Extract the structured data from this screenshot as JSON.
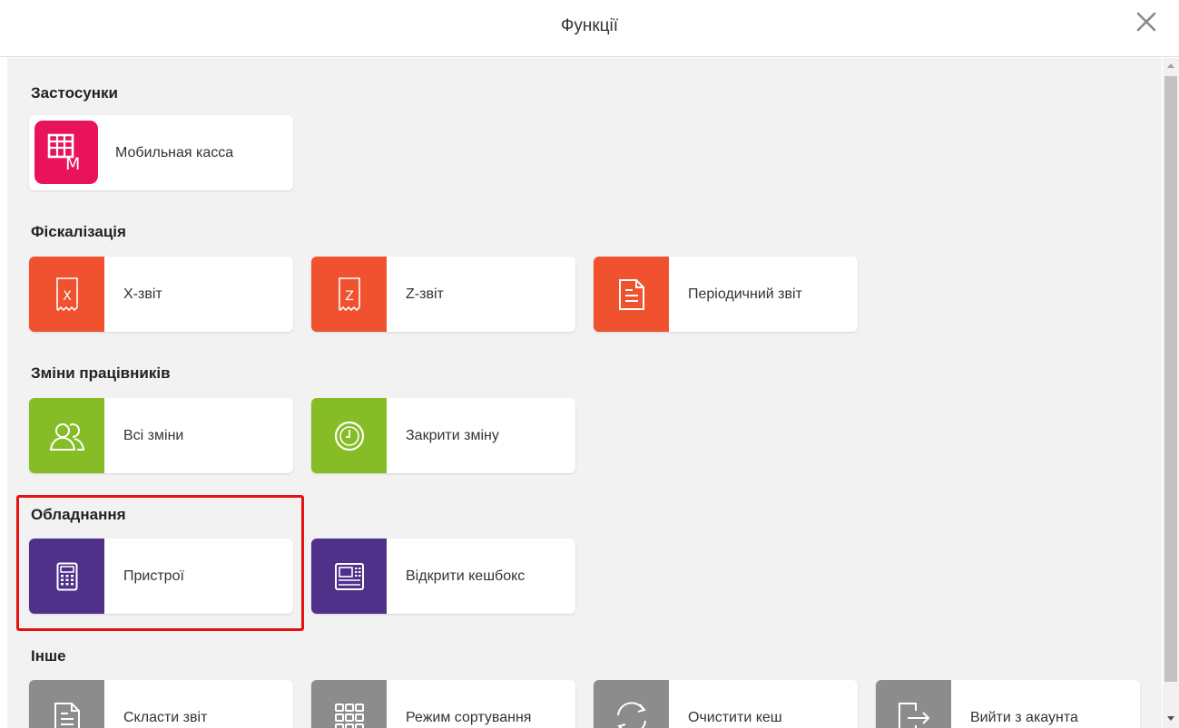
{
  "header": {
    "title": "Функції",
    "close_icon": "close-icon"
  },
  "colors": {
    "app": "#e8135a",
    "fiscal": "#f0522f",
    "shifts": "#86bc25",
    "equipment": "#50318a",
    "other": "#8c8c8c",
    "highlight": "#e81010"
  },
  "sections": {
    "apps": {
      "title": "Застосунки",
      "items": [
        {
          "label": "Мобильная касса",
          "icon": "mobile-cash-register-icon",
          "icon_letter": "M"
        }
      ]
    },
    "fiscal": {
      "title": "Фіскалізація",
      "items": [
        {
          "label": "X-звіт",
          "icon": "x-report-icon",
          "icon_letter": "X"
        },
        {
          "label": "Z-звіт",
          "icon": "z-report-icon",
          "icon_letter": "Z"
        },
        {
          "label": "Періодичний звіт",
          "icon": "document-icon"
        }
      ]
    },
    "shifts": {
      "title": "Зміни працівників",
      "items": [
        {
          "label": "Всі зміни",
          "icon": "users-icon"
        },
        {
          "label": "Закрити зміну",
          "icon": "clock-icon"
        }
      ]
    },
    "equipment": {
      "title": "Обладнання",
      "items": [
        {
          "label": "Пристрої",
          "icon": "calculator-icon"
        },
        {
          "label": "Відкрити кешбокс",
          "icon": "cash-register-icon"
        }
      ]
    },
    "other": {
      "title": "Інше",
      "items": [
        {
          "label": "Скласти звіт",
          "icon": "document-icon"
        },
        {
          "label": "Режим сортування",
          "icon": "grid-icon"
        },
        {
          "label": "Очистити кеш",
          "icon": "refresh-icon"
        },
        {
          "label": "Вийти з акаунта",
          "icon": "logout-icon"
        }
      ]
    }
  }
}
